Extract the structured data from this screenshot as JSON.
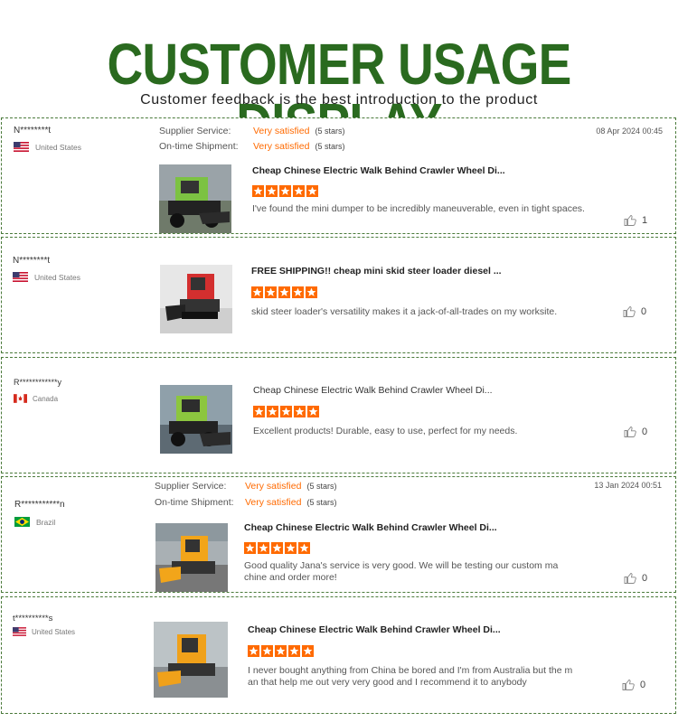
{
  "header": {
    "title": "CUSTOMER USAGE DISPLAY",
    "subtitle": "Customer feedback is the best introduction to the product"
  },
  "colors": {
    "title_green": "#2a6a1f",
    "accent_orange": "#ff6a00",
    "border_green": "#4a7a3a"
  },
  "reviews": [
    {
      "name": "N********t",
      "country": "United States",
      "flag": "us",
      "supplier_label": "Supplier Service:",
      "supplier_value": "Very satisfied",
      "supplier_stars": "(5 stars)",
      "shipment_label": "On-time Shipment:",
      "shipment_value": "Very satisfied",
      "shipment_stars": "(5 stars)",
      "date": "08 Apr 2024 00:45",
      "product_title": "Cheap Chinese Electric Walk Behind Crawler Wheel Di...",
      "rating": 5,
      "text": "I've found the mini dumper to be incredibly maneuverable, even in tight spaces.",
      "likes": "1"
    },
    {
      "name": "N********t",
      "country": "United States",
      "flag": "us",
      "product_title": "FREE SHIPPING!! cheap mini skid steer loader diesel ...",
      "rating": 5,
      "text": "skid steer loader's versatility makes it a jack-of-all-trades on my worksite.",
      "likes": "0"
    },
    {
      "name": "R************y",
      "country": "Canada",
      "flag": "ca",
      "product_title": "Cheap Chinese Electric Walk Behind Crawler Wheel Di...",
      "rating": 5,
      "text": "Excellent products! Durable, easy to use, perfect for my needs.",
      "likes": "0"
    },
    {
      "name": "R***********n",
      "country": "Brazil",
      "flag": "br",
      "supplier_label": "Supplier Service:",
      "supplier_value": "Very satisfied",
      "supplier_stars": "(5 stars)",
      "shipment_label": "On-time Shipment:",
      "shipment_value": "Very satisfied",
      "shipment_stars": "(5 stars)",
      "date": "13 Jan 2024 00:51",
      "product_title": "Cheap Chinese Electric Walk Behind Crawler Wheel Di...",
      "rating": 5,
      "text": "Good quality Jana's service is very good. We will be testing our custom machine and order more!",
      "likes": "0"
    },
    {
      "name": "t**********s",
      "country": "United States",
      "flag": "us",
      "product_title": "Cheap Chinese Electric Walk Behind Crawler Wheel Di...",
      "rating": 5,
      "text": "I never bought anything from China be bored and I'm from Australia but the man that help me out very very good and I recommend it to anybody",
      "likes": "0"
    }
  ]
}
